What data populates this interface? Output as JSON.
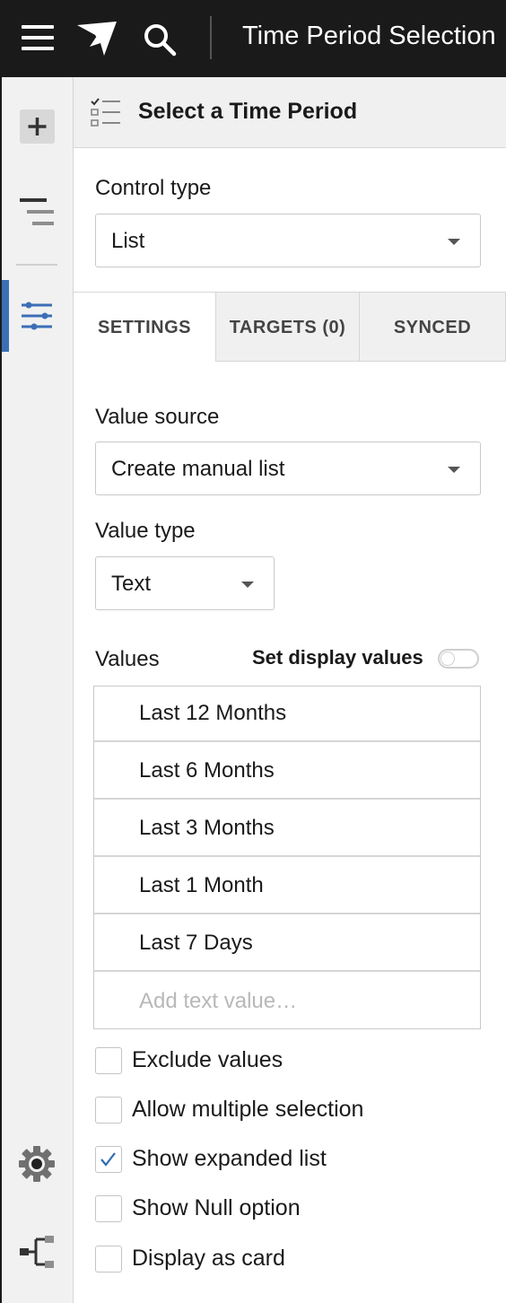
{
  "header": {
    "title": "Time Period Selection"
  },
  "panel": {
    "title": "Select a Time Period",
    "control_type": {
      "label": "Control type",
      "value": "List"
    },
    "tabs": [
      {
        "label": "SETTINGS",
        "active": true
      },
      {
        "label": "TARGETS (0)",
        "active": false
      },
      {
        "label": "SYNCED",
        "active": false
      }
    ],
    "value_source": {
      "label": "Value source",
      "value": "Create manual list"
    },
    "value_type": {
      "label": "Value type",
      "value": "Text"
    },
    "values": {
      "label": "Values",
      "set_display_label": "Set display values",
      "set_display_on": false,
      "items": [
        "Last 12 Months",
        "Last 6 Months",
        "Last 3 Months",
        "Last 1 Month",
        "Last 7 Days"
      ],
      "add_placeholder": "Add text value…"
    },
    "options": [
      {
        "label": "Exclude values",
        "checked": false
      },
      {
        "label": "Allow multiple selection",
        "checked": false
      },
      {
        "label": "Show expanded list",
        "checked": true
      },
      {
        "label": "Show Null option",
        "checked": false
      },
      {
        "label": "Display as card",
        "checked": false
      }
    ]
  },
  "colors": {
    "topbar": "#1a1a1a",
    "accent": "#3b6fb5",
    "check": "#2f6bb3"
  },
  "icons": {
    "topbar": [
      "hamburger-icon",
      "logo-icon",
      "search-icon"
    ],
    "rail": [
      "add-icon",
      "outline-icon",
      "properties-icon",
      "gear-icon",
      "lineage-icon"
    ],
    "panel": [
      "list-control-icon",
      "chevron-down-icon",
      "checkmark-icon"
    ]
  }
}
